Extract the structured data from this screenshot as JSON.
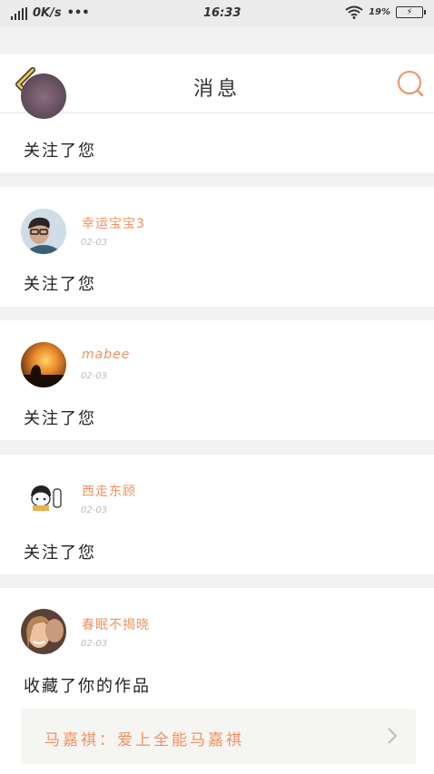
{
  "status_bar": {
    "network_speed": "0K/s",
    "more": "•••",
    "time": "16:33",
    "battery_percent": "19%"
  },
  "header": {
    "title": "消息",
    "back_icon": "chevron-left-icon",
    "search_icon": "search-icon"
  },
  "messages": [
    {
      "action": "关注了您"
    },
    {
      "username": "幸运宝宝3",
      "date": "02-03",
      "action": "关注了您"
    },
    {
      "username": "mabee",
      "date": "02-03",
      "action": "关注了您"
    },
    {
      "username": "西走东顾",
      "date": "02-03",
      "action": "关注了您"
    },
    {
      "username": "春眠不揭晓",
      "date": "02-03",
      "action": "收藏了你的作品",
      "link_text": "马嘉祺：爱上全能马嘉祺"
    }
  ],
  "colors": {
    "accent": "#f0915f",
    "back_arrow": "#e8c84a",
    "background": "#f2f2f2"
  }
}
